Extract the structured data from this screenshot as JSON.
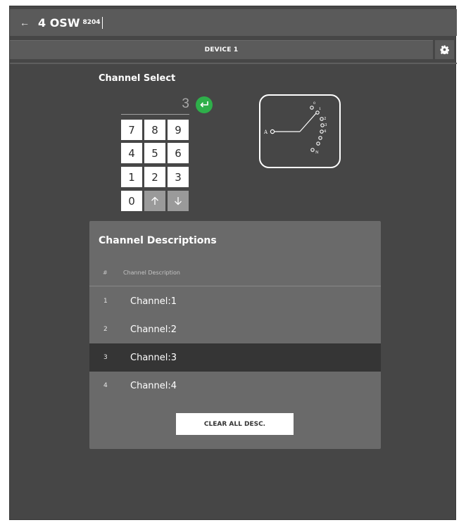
{
  "header": {
    "title": "4 OSW",
    "subtitle": "8204"
  },
  "device_bar": {
    "label": "DEVICE 1"
  },
  "channel_select": {
    "title": "Channel Select",
    "entry_value": "3",
    "keypad": [
      "7",
      "8",
      "9",
      "4",
      "5",
      "6",
      "1",
      "2",
      "3",
      "0"
    ]
  },
  "switch_diagram": {
    "input_label": "A",
    "output_labels": [
      "0",
      "1",
      "2",
      "3",
      "4",
      "N"
    ]
  },
  "descriptions": {
    "title": "Channel Descriptions",
    "col_num": "#",
    "col_desc": "Channel Description",
    "rows": [
      {
        "num": "1",
        "desc": "Channel:1"
      },
      {
        "num": "2",
        "desc": "Channel:2"
      },
      {
        "num": "3",
        "desc": "Channel:3"
      },
      {
        "num": "4",
        "desc": "Channel:4"
      }
    ],
    "clear_label": "CLEAR ALL DESC."
  },
  "colors": {
    "enter": "#2eaf4a",
    "selected_row": "#353535"
  }
}
